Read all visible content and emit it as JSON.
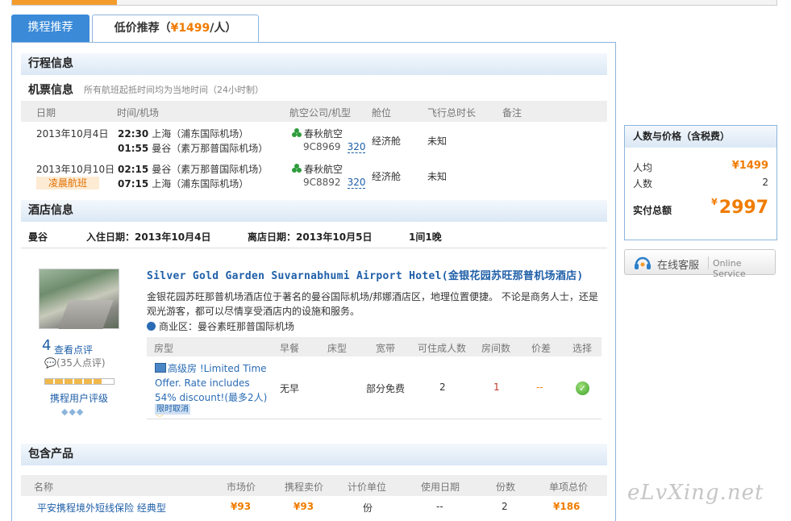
{
  "tabs": {
    "ctrip": "携程推荐",
    "lowprice_prefix": "低价推荐（",
    "lowprice_price": "¥1499",
    "lowprice_suffix": "/人）"
  },
  "itinerary": {
    "title": "行程信息",
    "flight_title": "机票信息",
    "flight_note": "所有航班起抵时间均为当地时间（24小时制）",
    "columns": [
      "日期",
      "时间/机场",
      "航空公司/机型",
      "舱位",
      "飞行总时长",
      "备注"
    ],
    "flights": [
      {
        "date": "2013年10月4日",
        "tag": "",
        "dep_time": "22:30",
        "dep_airport": "上海（浦东国际机场）",
        "arr_time": "01:55",
        "arr_airport": "曼谷（素万那普国际机场）",
        "airline": "春秋航空",
        "code": "9C8969",
        "model": "320",
        "cabin": "经济舱",
        "duration": "未知"
      },
      {
        "date": "2013年10月10日",
        "tag": "凌晨航班",
        "dep_time": "02:15",
        "dep_airport": "曼谷（素万那普国际机场）",
        "arr_time": "07:15",
        "arr_airport": "上海（浦东国际机场）",
        "airline": "春秋航空",
        "code": "9C8892",
        "model": "320",
        "cabin": "经济舱",
        "duration": "未知"
      }
    ]
  },
  "hotel": {
    "title": "酒店信息",
    "city": "曼谷",
    "checkin": "入住日期：2013年10月4日",
    "checkout": "离店日期：2013年10月5日",
    "rooms_nights": "1间1晚",
    "name": "Silver Gold Garden Suvarnabhumi Airport Hotel(金银花园苏旺那普机场酒店)",
    "description": "金银花园苏旺那普机场酒店位于著名的曼谷国际机场/邦娜酒店区，地理位置便捷。 不论是商务人士，还是观光游客，都可以尽情享受酒店内的设施和服务。",
    "area": "商业区：曼谷素旺那普国际机场",
    "score": "4",
    "review_link": "查看点评",
    "review_count": "(35人点评)",
    "rating_label": "携程用户评级",
    "diamonds": "◆◆◆",
    "room_columns": [
      "房型",
      "早餐",
      "床型",
      "宽带",
      "可住成人数",
      "房间数",
      "价差",
      "选择"
    ],
    "room": {
      "name": "高级房 !Limited Time Offer. Rate includes 54% discount!(最多2人)",
      "warn": "ⓘ",
      "cancel": "限时取消",
      "breakfast": "无早",
      "bed": "",
      "broadband": "部分免费",
      "adults": "2",
      "rooms": "1",
      "diff": "--"
    }
  },
  "products": {
    "title": "包含产品",
    "columns": [
      "名称",
      "市场价",
      "携程卖价",
      "计价单位",
      "使用日期",
      "份数",
      "单项总价"
    ],
    "rows": [
      {
        "name": "平安携程境外短线保险 经典型",
        "market": "¥93",
        "price": "¥93",
        "unit": "份",
        "date": "--",
        "qty": "2",
        "total": "¥186"
      }
    ]
  },
  "summary": {
    "title": "人数与价格（含税费）",
    "per_person_label": "人均",
    "per_person": "¥1499",
    "people_label": "人数",
    "people": "2",
    "total_label": "实付总额",
    "total_symbol": "¥",
    "total": "2997"
  },
  "service": {
    "cn": "在线客服",
    "en": "Online Service"
  },
  "watermark": "eLvXing.net"
}
